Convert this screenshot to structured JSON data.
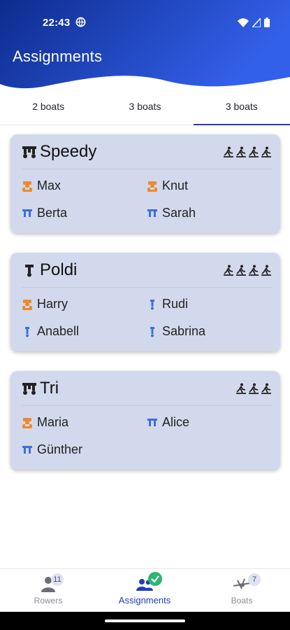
{
  "status_bar": {
    "time": "22:43"
  },
  "header": {
    "title": "Assignments"
  },
  "tabs": [
    {
      "label": "2 boats",
      "active": false
    },
    {
      "label": "3 boats",
      "active": false
    },
    {
      "label": "3 boats",
      "active": true
    }
  ],
  "boats": [
    {
      "name": "Speedy",
      "boat_icon": "double-seat-boat-icon",
      "rower_count": 4,
      "people": [
        {
          "name": "Max",
          "role": "cox",
          "icon": "cox-icon"
        },
        {
          "name": "Knut",
          "role": "cox",
          "icon": "cox-icon"
        },
        {
          "name": "Berta",
          "role": "rower",
          "icon": "double-oar-icon"
        },
        {
          "name": "Sarah",
          "role": "rower",
          "icon": "double-oar-icon"
        }
      ]
    },
    {
      "name": "Poldi",
      "boat_icon": "single-seat-boat-icon",
      "rower_count": 4,
      "people": [
        {
          "name": "Harry",
          "role": "cox",
          "icon": "cox-icon"
        },
        {
          "name": "Rudi",
          "role": "rower",
          "icon": "single-oar-icon"
        },
        {
          "name": "Anabell",
          "role": "rower",
          "icon": "single-oar-icon"
        },
        {
          "name": "Sabrina",
          "role": "rower",
          "icon": "single-oar-icon"
        }
      ]
    },
    {
      "name": "Tri",
      "boat_icon": "double-seat-boat-icon",
      "rower_count": 3,
      "people": [
        {
          "name": "Maria",
          "role": "cox",
          "icon": "cox-icon"
        },
        {
          "name": "Alice",
          "role": "rower",
          "icon": "double-oar-icon"
        },
        {
          "name": "Günther",
          "role": "rower",
          "icon": "double-oar-icon"
        }
      ]
    }
  ],
  "bottom_nav": {
    "rowers": {
      "label": "Rowers",
      "badge": "11"
    },
    "assignments": {
      "label": "Assignments"
    },
    "boats": {
      "label": "Boats",
      "badge": "7"
    }
  },
  "colors": {
    "header_gradient_start": "#0e2c8e",
    "header_gradient_end": "#2f59e6",
    "card_bg": "#d2d9ec",
    "accent": "#1f3cb8",
    "cox_orange": "#f0892c",
    "oar_blue": "#3d6ee0"
  }
}
